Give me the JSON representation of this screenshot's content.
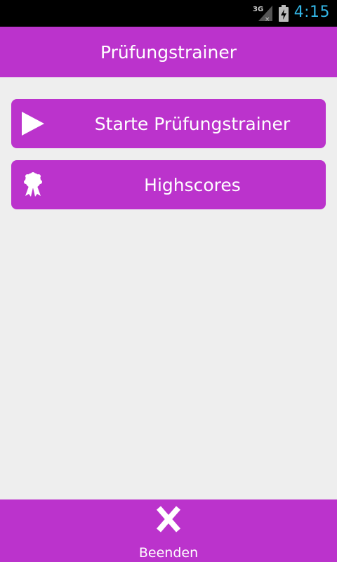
{
  "status_bar": {
    "network_label": "3G",
    "time": "4:15",
    "time_color": "#33b5e5"
  },
  "header": {
    "title": "Prüfungstrainer"
  },
  "menu": {
    "start": {
      "label": "Starte Prüfungstrainer",
      "icon": "play-icon"
    },
    "highscores": {
      "label": "Highscores",
      "icon": "award-ribbon-icon"
    }
  },
  "footer": {
    "exit_label": "Beenden",
    "icon": "close-x-icon"
  },
  "colors": {
    "accent": "#bb33cc",
    "background": "#eeeeee",
    "status_bar": "#000000",
    "text_on_accent": "#ffffff"
  }
}
